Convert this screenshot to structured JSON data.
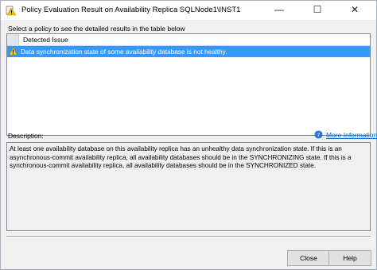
{
  "window": {
    "title": "Policy Evaluation Result on Availability Replica SQLNode1\\INST1",
    "minimize_glyph": "—",
    "maximize_glyph": "☐",
    "close_glyph": "✕"
  },
  "instruction": "Select a policy to see the detailed results in the table below",
  "grid": {
    "column_header": "Detected Issue",
    "rows": [
      {
        "icon": "warning-icon",
        "text": "Data synchronization state of some availability database is not healthy."
      }
    ]
  },
  "description": {
    "label": "Description:",
    "more_info": "More Information",
    "text": "At least one availability database on this availability replica has an unhealthy data synchronization state. If this is an asynchronous-commit availability replica, all availability databases should be in the SYNCHRONIZING state. If this is a synchronous-commit availability replica, all availability databases should be in the SYNCHRONIZED state."
  },
  "buttons": {
    "close": "Close",
    "help": "Help"
  },
  "colors": {
    "selection": "#3399ff",
    "link": "#0066cc",
    "dialog_bg": "#f0f0f0"
  }
}
